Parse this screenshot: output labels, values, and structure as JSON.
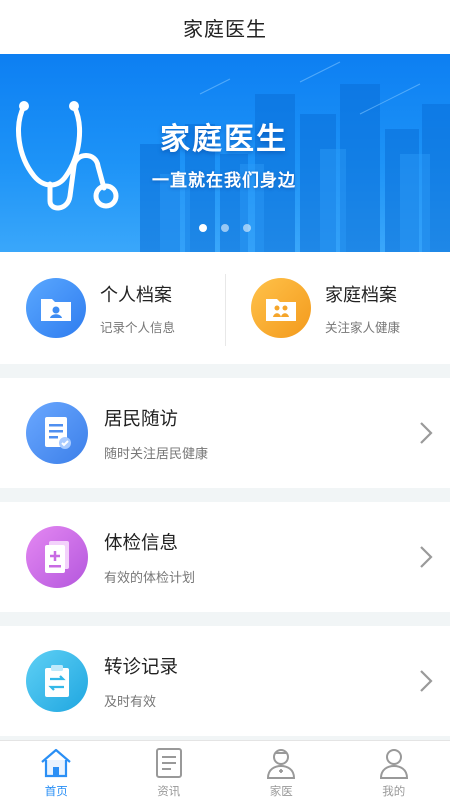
{
  "header": {
    "title": "家庭医生"
  },
  "banner": {
    "title": "家庭医生",
    "subtitle": "一直就在我们身边",
    "dots": 3,
    "active_dot": 0
  },
  "records": [
    {
      "title": "个人档案",
      "subtitle": "记录个人信息",
      "icon": "folder-person-icon",
      "color": "#3d8cf3"
    },
    {
      "title": "家庭档案",
      "subtitle": "关注家人健康",
      "icon": "folder-family-icon",
      "color": "#f5a52a"
    }
  ],
  "services": [
    {
      "title": "居民随访",
      "subtitle": "随时关注居民健康",
      "icon": "document-check-icon",
      "color": "#4f8ff0"
    },
    {
      "title": "体检信息",
      "subtitle": "有效的体检计划",
      "icon": "medical-file-icon",
      "color": "#c86be3"
    },
    {
      "title": "转诊记录",
      "subtitle": "及时有效",
      "icon": "clipboard-transfer-icon",
      "color": "#33b8e8"
    }
  ],
  "tabbar": {
    "items": [
      {
        "label": "首页",
        "icon": "home-icon",
        "active": true
      },
      {
        "label": "资讯",
        "icon": "news-icon",
        "active": false
      },
      {
        "label": "家医",
        "icon": "doctor-icon",
        "active": false
      },
      {
        "label": "我的",
        "icon": "user-icon",
        "active": false
      }
    ]
  },
  "colors": {
    "accent": "#2a8ff5",
    "banner": "#1688f5",
    "inactive": "#999999"
  }
}
